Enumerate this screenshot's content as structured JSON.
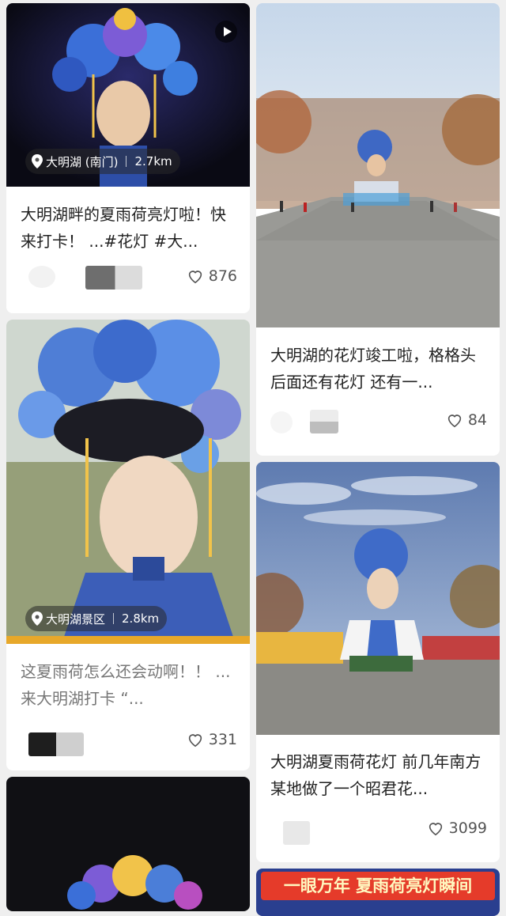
{
  "feed": [
    {
      "location": "大明湖 (南门)",
      "distance": "2.7km",
      "title": "大明湖畔的夏雨荷亮灯啦！快来打卡！ ...#花灯 #大...",
      "likes": "876"
    },
    {
      "title": "大明湖的花灯竣工啦，格格头后面还有花灯 还有一...",
      "likes": "84"
    },
    {
      "location": "大明湖景区",
      "distance": "2.8km",
      "title": "这夏雨荷怎么还会动啊！！ ...来大明湖打卡 “...",
      "likes": "331"
    },
    {
      "title": "大明湖夏雨荷花灯 前几年南方某地做了一个昭君花...",
      "likes": "3099"
    },
    {
      "banner": "一眼万年 夏雨荷亮灯瞬间"
    }
  ],
  "colors": {
    "background": "#efefef",
    "card": "#ffffff",
    "banner": "#e53b2a"
  },
  "icons": [
    "location-pin-icon",
    "play-icon",
    "heart-icon"
  ]
}
